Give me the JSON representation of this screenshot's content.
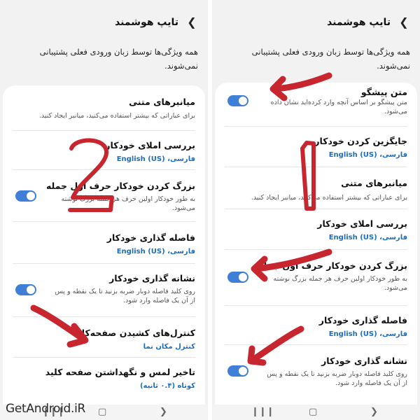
{
  "header": {
    "title": "تایپ هوشمند",
    "back_icon": "chevron-back-icon"
  },
  "description": "همه ویژگی‌ها توسط زبان ورودی فعلی پشتیبانی نمی‌شوند.",
  "left": {
    "items": [
      {
        "title": "میانبرهای متنی",
        "subtitle": "برای عباراتی که بیشتر استفاده می‌کنید، میانبر ایجاد کنید."
      },
      {
        "title": "بررسی املای خودکار",
        "value": "فارسی، English (US)"
      },
      {
        "title": "بزرگ کردن خودکار حرف اول جمله",
        "subtitle": "به طور خودکار اولین حرف هر جمله بزرگ نوشته می‌شود.",
        "toggle": true
      },
      {
        "title": "فاصله گذاری خودکار",
        "value": "فارسی، English (US)"
      },
      {
        "title": "نشانه گذاری خودکار",
        "subtitle": "روی کلید فاصله دوبار ضربه بزنید تا یک نقطه و پس از آن یک فاصله وارد شود.",
        "toggle": true
      },
      {
        "title": "کنترل‌های کشیدن صفحه‌کلید",
        "value": "کنترل مکان نما"
      },
      {
        "title": "تاخیر لمس و نگهداشتن صفحه کلید",
        "value": "کوتاه (۰.۴ ثانیه)"
      }
    ]
  },
  "right": {
    "items": [
      {
        "title": "متن پیشگو",
        "subtitle": "متن پیشگو بر اساس آنچه وارد کرده‌اید نشان داده می‌شود.",
        "toggle": true
      },
      {
        "title": "جایگزین کردن خودکار",
        "value": "فارسی، English (US)"
      },
      {
        "title": "میانبرهای متنی",
        "subtitle": "برای عباراتی که بیشتر استفاده می‌کنید، میانبر ایجاد کنید."
      },
      {
        "title": "بررسی املای خودکار",
        "value": "فارسی، English (US)"
      },
      {
        "title": "بزرگ کردن خودکار حرف اول جمله",
        "subtitle": "به طور خودکار اولین حرف هر جمله بزرگ نوشته می‌شود.",
        "toggle": true
      },
      {
        "title": "فاصله گذاری خودکار",
        "value": "فارسی، English (US)"
      },
      {
        "title": "نشانه گذاری خودکار",
        "subtitle": "روی کلید فاصله دوبار ضربه بزنید تا یک نقطه و پس از آن یک فاصله وارد شود.",
        "toggle": true
      }
    ]
  },
  "nav": {
    "recent_icon": "recent-apps-icon",
    "home_icon": "home-icon",
    "back_icon": "nav-back-icon"
  },
  "watermark": "GetAndroid.iR",
  "annotations": {
    "arrow_color": "#c8262f",
    "left_number": "۲",
    "right_number": "۱"
  }
}
